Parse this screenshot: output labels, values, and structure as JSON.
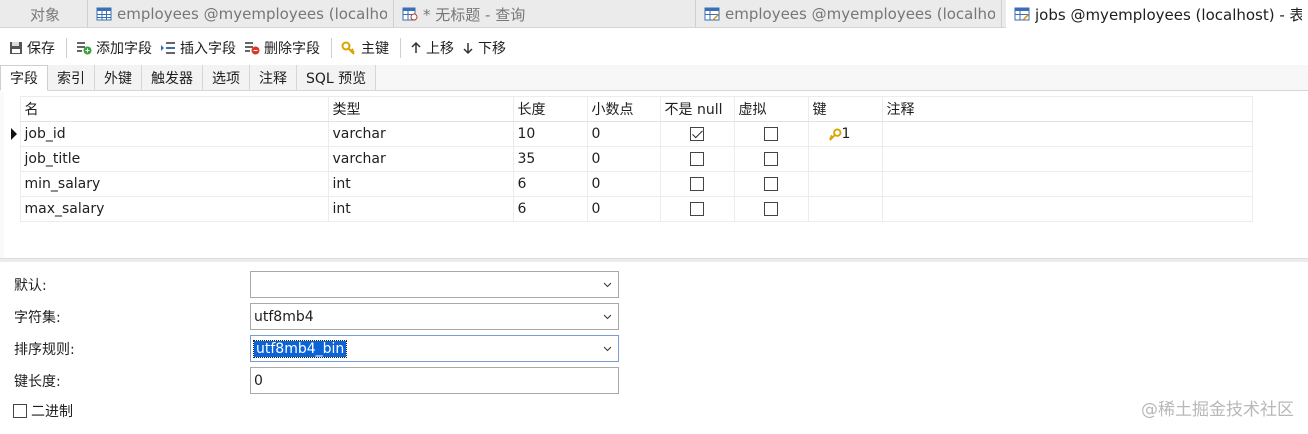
{
  "tabs": [
    {
      "label": "对象",
      "icon": "none"
    },
    {
      "label": "employees @myemployees (localho...",
      "icon": "table-icon"
    },
    {
      "label": "* 无标题 - 查询",
      "icon": "query-icon"
    },
    {
      "label": "employees @myemployees (localho...",
      "icon": "table-design-icon"
    },
    {
      "label": "jobs @myemployees (localhost) - 表",
      "icon": "table-design-icon",
      "active": true
    }
  ],
  "toolbar": {
    "save": "保存",
    "add_field": "添加字段",
    "insert_field": "插入字段",
    "delete_field": "删除字段",
    "primary_key": "主键",
    "move_up": "上移",
    "move_down": "下移"
  },
  "subtabs": [
    "字段",
    "索引",
    "外键",
    "触发器",
    "选项",
    "注释",
    "SQL 预览"
  ],
  "grid": {
    "headers": [
      "名",
      "类型",
      "长度",
      "小数点",
      "不是 null",
      "虚拟",
      "键",
      "注释"
    ],
    "rows": [
      {
        "name": "job_id",
        "type": "varchar",
        "length": "10",
        "decimals": "0",
        "not_null": true,
        "virtual": false,
        "key": "1",
        "comment": ""
      },
      {
        "name": "job_title",
        "type": "varchar",
        "length": "35",
        "decimals": "0",
        "not_null": false,
        "virtual": false,
        "key": "",
        "comment": ""
      },
      {
        "name": "min_salary",
        "type": "int",
        "length": "6",
        "decimals": "0",
        "not_null": false,
        "virtual": false,
        "key": "",
        "comment": ""
      },
      {
        "name": "max_salary",
        "type": "int",
        "length": "6",
        "decimals": "0",
        "not_null": false,
        "virtual": false,
        "key": "",
        "comment": ""
      }
    ]
  },
  "properties": {
    "default_label": "默认:",
    "default_value": "",
    "charset_label": "字符集:",
    "charset_value": "utf8mb4",
    "collation_label": "排序规则:",
    "collation_value": "utf8mb4_bin",
    "key_length_label": "键长度:",
    "key_length_value": "0",
    "binary_label": "二进制",
    "binary_checked": false
  },
  "watermark": "@稀土掘金技术社区",
  "colors": {
    "selection": "#0a64d8",
    "key_icon": "#d9a400",
    "tab_bar": "#ebebeb"
  }
}
